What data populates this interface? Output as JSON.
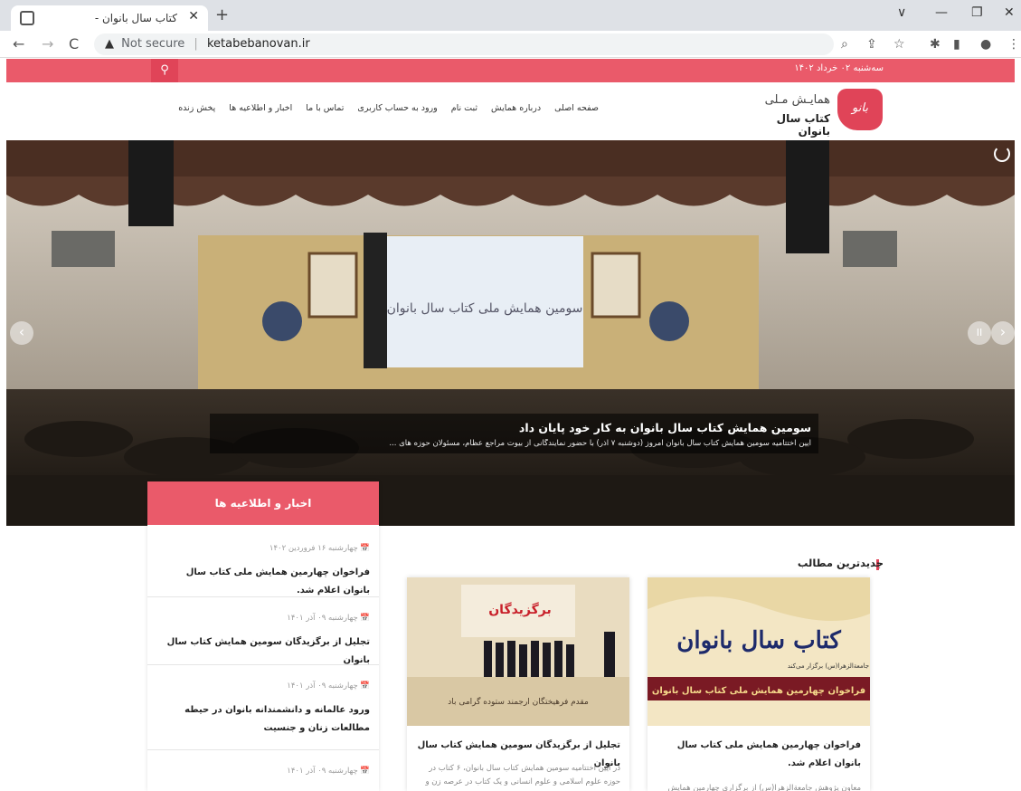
{
  "browser": {
    "tab_title": "کتاب سال بانوان -",
    "tab_close": "✕",
    "new_tab": "+",
    "url_warning": "Not secure",
    "url": "ketabebanovan.ir",
    "window": {
      "minimize": "—",
      "maximize": "❐",
      "close": "✕",
      "chevron": "∨"
    }
  },
  "site": {
    "date": "سه‌شنبه ۰۲ خرداد ۱۴۰۲",
    "search_icon": "search-icon",
    "logo": {
      "line1": "همایـش مـلی",
      "line2": "کتاب سال بانوان",
      "mark": "بانو"
    },
    "menu": [
      "صفحه اصلی",
      "درباره همایش",
      "ثبت نام",
      "ورود به حساب کاربری",
      "تماس با ما",
      "اخبار و اطلاعیه ها",
      "پخش زنده"
    ],
    "slider": {
      "title": "سومین همایش کتاب سال بانوان به کار خود پایان داد",
      "summary": "آیین اختتامیه سومین همایش کتاب سال بانوان امروز (دوشنبه ۷ آذر) با حضور نمایندگانی از بیوت مراجع عظام، مسئولان حوزه های ...",
      "prev": "‹",
      "next": "›",
      "pause": "II",
      "backdrop_text": "سومین همایش ملی کتاب سال بانوان"
    },
    "news": {
      "header": "اخبار و اطلاعیه ها",
      "items": [
        {
          "date": "📅 چهارشنبه ۱۶ فروردین ۱۴۰۲",
          "title": "فراخوان چهارمین همایش ملی کتاب سال بانوان اعلام شد."
        },
        {
          "date": "📅 چهارشنبه ۰۹ آذر ۱۴۰۱",
          "title": "تجلیل از برگزیدگان سومین همایش کتاب سال بانوان"
        },
        {
          "date": "📅 چهارشنبه ۰۹ آذر ۱۴۰۱",
          "title": "ورود عالمانه و دانشمندانه بانوان در حیطه مطالعات زنان و جنسیت"
        },
        {
          "date": "📅 چهارشنبه ۰۹ آذر ۱۴۰۱",
          "title": ""
        }
      ]
    },
    "latest": {
      "title": "جدیدترین مطالب",
      "cards": [
        {
          "img_title": "کتاب سال بانوان",
          "img_sub": "جامعةالزهرا(س) برگزار می‌کند",
          "img_banner": "فراخوان چهارمین همایش ملی کتاب سال بانوان",
          "title": "فراخوان چهارمین همایش ملی کتاب سال بانوان اعلام شد.",
          "excerpt": "معاون پژوهش جامعةالزهرا(س) از برگزاری چهارمین همایش"
        },
        {
          "img_title": "برگزیدگان",
          "img_sub": "مقدم فرهیختگان ارجمند ستوده گرامی باد",
          "title": "تجلیل از برگزیدگان سومین همایش کتاب سال بانوان",
          "excerpt": "در آیین اختتامیه سومین همایش کتاب سال بانوان، ۶ کتاب در حوزه علوم اسلامی و علوم انسانی و یک کتاب در عرصه زن و"
        }
      ]
    }
  },
  "colors": {
    "accent": "#ea5a6a",
    "accent_dark": "#e04458"
  }
}
